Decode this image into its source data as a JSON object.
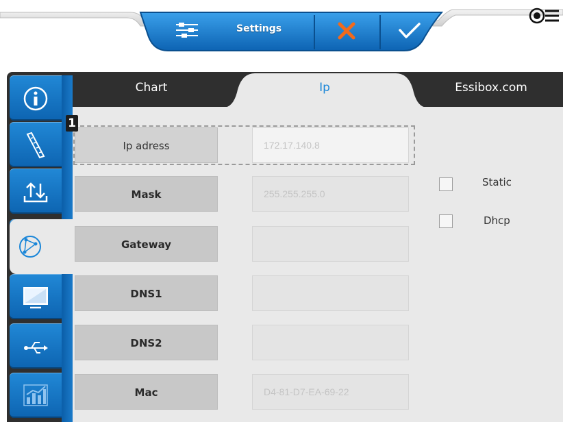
{
  "toolbar": {
    "settings_label": "Settings",
    "settings_icon": "sliders-icon",
    "cancel_icon": "close-icon",
    "confirm_icon": "check-icon",
    "menu_icon": "menu-icon",
    "accent": "#1a86d8",
    "cancel_color": "#f26a1b"
  },
  "sidebar": {
    "items": [
      {
        "icon": "info-icon"
      },
      {
        "icon": "ruler-icon"
      },
      {
        "icon": "upload-download-icon"
      },
      {
        "icon": "network-icon",
        "active": true
      },
      {
        "icon": "display-icon"
      },
      {
        "icon": "usb-icon"
      },
      {
        "icon": "chart-icon"
      }
    ]
  },
  "tabs": [
    {
      "label": "Chart"
    },
    {
      "label": "Ip",
      "active": true
    },
    {
      "label": "Essibox.com"
    }
  ],
  "annotation": {
    "number": "1"
  },
  "form": {
    "rows": [
      {
        "label": "Ip adress",
        "value": "172.17.140.8"
      },
      {
        "label": "Mask",
        "value": "255.255.255.0"
      },
      {
        "label": "Gateway",
        "value": ""
      },
      {
        "label": "DNS1",
        "value": ""
      },
      {
        "label": "DNS2",
        "value": ""
      },
      {
        "label": "Mac",
        "value": "D4-81-D7-EA-69-22"
      }
    ]
  },
  "mode": {
    "static_label": "Static",
    "dhcp_label": "Dhcp"
  }
}
